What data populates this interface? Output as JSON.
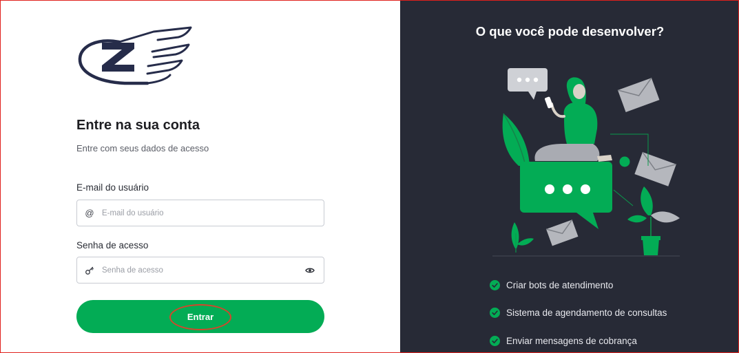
{
  "colors": {
    "accent_green": "#03ac55",
    "dark_panel": "#272a36",
    "logo_navy": "#262c4a",
    "annotation_red": "#d6452b"
  },
  "login": {
    "title": "Entre na sua conta",
    "subtitle": "Entre com seus dados de acesso",
    "email": {
      "label": "E-mail do usuário",
      "placeholder": "E-mail do usuário",
      "value": "",
      "icon": "at-sign-icon",
      "icon_glyph": "@"
    },
    "password": {
      "label": "Senha de acesso",
      "placeholder": "Senha de acesso",
      "value": "",
      "icon": "key-icon",
      "icon_glyph": "⚷"
    },
    "submit_label": "Entrar"
  },
  "promo": {
    "title": "O que você pode desenvolver?",
    "benefits": [
      {
        "text": "Criar bots de atendimento",
        "icon": "check-circle-icon"
      },
      {
        "text": "Sistema de agendamento de consultas",
        "icon": "check-circle-icon"
      },
      {
        "text": "Enviar mensagens de cobrança",
        "icon": "check-circle-icon"
      }
    ]
  }
}
